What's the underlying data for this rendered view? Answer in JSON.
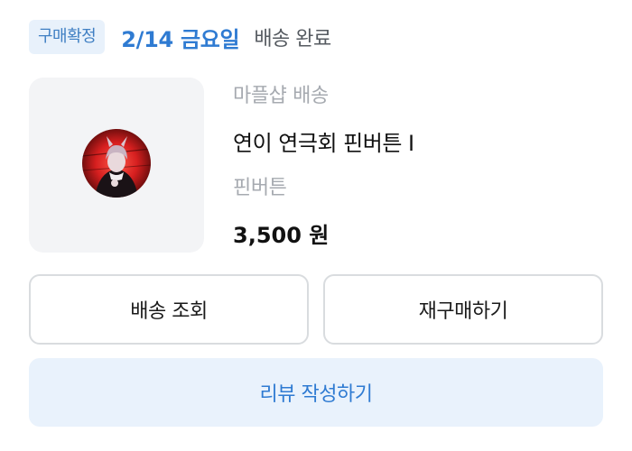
{
  "order": {
    "status_badge": "구매확정",
    "date": "2/14 금요일",
    "delivery_status": "배송 완료"
  },
  "product": {
    "seller": "마플샵 배송",
    "name": "연이 연극회 핀버튼 I",
    "option": "핀버튼",
    "price": "3,500 원",
    "image_icon": "product-thumbnail"
  },
  "actions": {
    "track_label": "배송 조회",
    "rebuy_label": "재구매하기",
    "review_label": "리뷰 작성하기"
  },
  "colors": {
    "accent": "#2f7bd2",
    "badge_bg": "#e8f1fb",
    "review_bg": "#e9f2fc",
    "muted_text": "#a6aab0"
  }
}
